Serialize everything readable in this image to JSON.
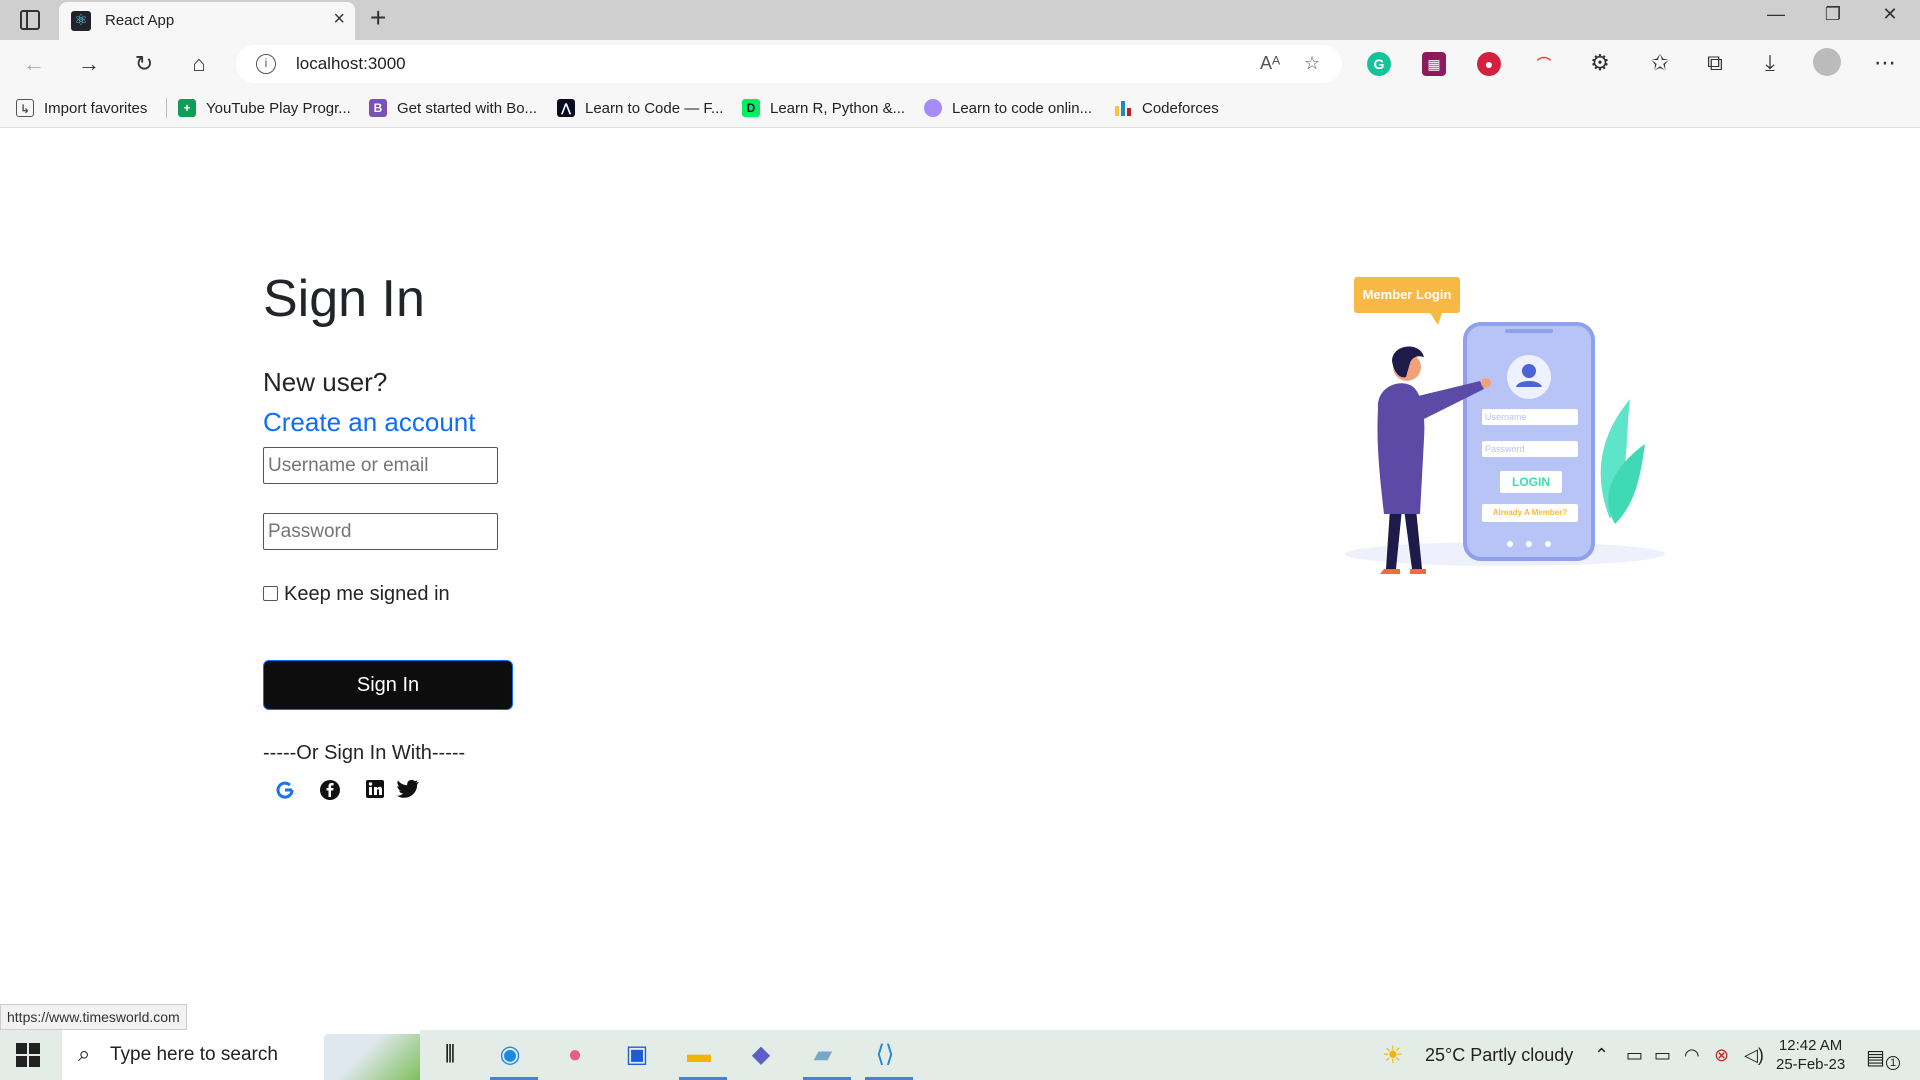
{
  "browser": {
    "tab_title": "React App",
    "url": "localhost:3000",
    "status_url": "https://www.timesworld.com"
  },
  "bookmarks": [
    {
      "label": "Import favorites",
      "icon": "import-icon",
      "color": "#555555"
    },
    {
      "label": "YouTube Play Progr...",
      "icon": "sheets-icon",
      "color": "#0f9d58"
    },
    {
      "label": "Get started with Bo...",
      "icon": "bootstrap-icon",
      "color": "#7952b3"
    },
    {
      "label": "Learn to Code — F...",
      "icon": "freecodecamp-icon",
      "color": "#0a0a23"
    },
    {
      "label": "Learn R, Python &...",
      "icon": "datacamp-icon",
      "color": "#03ef62"
    },
    {
      "label": "Learn to code onlin...",
      "icon": "avatar-icon",
      "color": "#a78bfa"
    },
    {
      "label": "Codeforces",
      "icon": "codeforces-icon",
      "color": "#1f8acb"
    }
  ],
  "page": {
    "title": "Sign In",
    "new_user": "New user?",
    "create_account": "Create an account",
    "username_placeholder": "Username or email",
    "password_placeholder": "Password",
    "keep_signed_in": "Keep me signed in",
    "signin_button": "Sign In",
    "or_signin_with": "-----Or Sign In With-----",
    "social": [
      "google-icon",
      "facebook-icon",
      "linkedin-icon",
      "twitter-icon"
    ]
  },
  "illustration": {
    "bubble": "Member Login",
    "username_field": "Username",
    "password_field": "Password",
    "login_button": "LOGIN",
    "already_member": "Already A Member?",
    "accent": "#f7b944",
    "phone_color": "#b8c4f5"
  },
  "taskbar": {
    "search_placeholder": "Type here to search",
    "weather": "25°C  Partly cloudy",
    "time": "12:42 AM",
    "date": "25-Feb-23",
    "notifications": "1"
  }
}
